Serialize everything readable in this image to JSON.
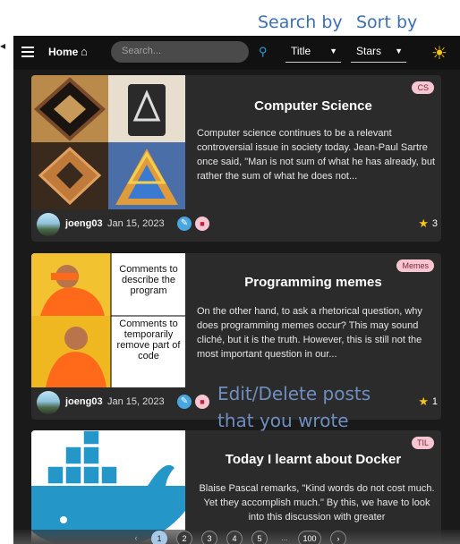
{
  "annotations": {
    "search_by": "Search by",
    "sort_by": "Sort by",
    "edit_delete_line1": "Edit/Delete posts",
    "edit_delete_line2": "that you wrote"
  },
  "topbar": {
    "home_label": "Home",
    "search_placeholder": "Search...",
    "search_by_value": "Title",
    "sort_by_value": "Stars"
  },
  "posts": [
    {
      "title": "Computer Science",
      "tag": "CS",
      "body": "Computer science continues to be a relevant controversial issue in society today. Jean-Paul Sartre once said, \"Man is not sum of what he has already, but rather the sum of what he does not...",
      "author": "joeng03",
      "date": "Jan 15, 2023",
      "stars": "3"
    },
    {
      "title": "Programming memes",
      "tag": "Memes",
      "body": "On the other hand, to ask a rhetorical question, why does programming memes occur? This may sound cliché, but it is the truth. However, this is still not the most important question in our...",
      "author": "joeng03",
      "date": "Jan 15, 2023",
      "stars": "1",
      "meme_text_top": "Comments to describe the program",
      "meme_text_bottom": "Comments to temporarily remove part of code"
    },
    {
      "title": "Today I learnt about Docker",
      "tag": "TIL",
      "body": "Blaise Pascal remarks, \"Kind words do not cost much. Yet they accomplish much.\" By this, we have to look into this discussion with greater"
    }
  ],
  "pagination": {
    "prev": "‹",
    "pages": [
      "1",
      "2",
      "3",
      "4",
      "5"
    ],
    "ellipsis": "...",
    "last": "100",
    "next": "›"
  },
  "colors": {
    "annotation": "#3d6fb5",
    "accent": "#2f9fe0",
    "star": "#f5c518",
    "tag_bg": "#f7c6d0"
  }
}
